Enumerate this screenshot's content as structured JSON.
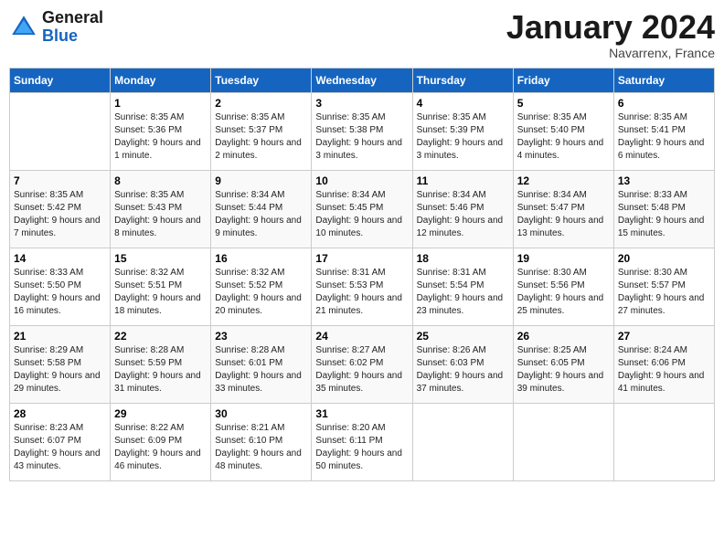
{
  "header": {
    "logo_general": "General",
    "logo_blue": "Blue",
    "month_title": "January 2024",
    "location": "Navarrenx, France"
  },
  "columns": [
    "Sunday",
    "Monday",
    "Tuesday",
    "Wednesday",
    "Thursday",
    "Friday",
    "Saturday"
  ],
  "weeks": [
    [
      {
        "day": "",
        "sunrise": "",
        "sunset": "",
        "daylight": ""
      },
      {
        "day": "1",
        "sunrise": "Sunrise: 8:35 AM",
        "sunset": "Sunset: 5:36 PM",
        "daylight": "Daylight: 9 hours and 1 minute."
      },
      {
        "day": "2",
        "sunrise": "Sunrise: 8:35 AM",
        "sunset": "Sunset: 5:37 PM",
        "daylight": "Daylight: 9 hours and 2 minutes."
      },
      {
        "day": "3",
        "sunrise": "Sunrise: 8:35 AM",
        "sunset": "Sunset: 5:38 PM",
        "daylight": "Daylight: 9 hours and 3 minutes."
      },
      {
        "day": "4",
        "sunrise": "Sunrise: 8:35 AM",
        "sunset": "Sunset: 5:39 PM",
        "daylight": "Daylight: 9 hours and 3 minutes."
      },
      {
        "day": "5",
        "sunrise": "Sunrise: 8:35 AM",
        "sunset": "Sunset: 5:40 PM",
        "daylight": "Daylight: 9 hours and 4 minutes."
      },
      {
        "day": "6",
        "sunrise": "Sunrise: 8:35 AM",
        "sunset": "Sunset: 5:41 PM",
        "daylight": "Daylight: 9 hours and 6 minutes."
      }
    ],
    [
      {
        "day": "7",
        "sunrise": "Sunrise: 8:35 AM",
        "sunset": "Sunset: 5:42 PM",
        "daylight": "Daylight: 9 hours and 7 minutes."
      },
      {
        "day": "8",
        "sunrise": "Sunrise: 8:35 AM",
        "sunset": "Sunset: 5:43 PM",
        "daylight": "Daylight: 9 hours and 8 minutes."
      },
      {
        "day": "9",
        "sunrise": "Sunrise: 8:34 AM",
        "sunset": "Sunset: 5:44 PM",
        "daylight": "Daylight: 9 hours and 9 minutes."
      },
      {
        "day": "10",
        "sunrise": "Sunrise: 8:34 AM",
        "sunset": "Sunset: 5:45 PM",
        "daylight": "Daylight: 9 hours and 10 minutes."
      },
      {
        "day": "11",
        "sunrise": "Sunrise: 8:34 AM",
        "sunset": "Sunset: 5:46 PM",
        "daylight": "Daylight: 9 hours and 12 minutes."
      },
      {
        "day": "12",
        "sunrise": "Sunrise: 8:34 AM",
        "sunset": "Sunset: 5:47 PM",
        "daylight": "Daylight: 9 hours and 13 minutes."
      },
      {
        "day": "13",
        "sunrise": "Sunrise: 8:33 AM",
        "sunset": "Sunset: 5:48 PM",
        "daylight": "Daylight: 9 hours and 15 minutes."
      }
    ],
    [
      {
        "day": "14",
        "sunrise": "Sunrise: 8:33 AM",
        "sunset": "Sunset: 5:50 PM",
        "daylight": "Daylight: 9 hours and 16 minutes."
      },
      {
        "day": "15",
        "sunrise": "Sunrise: 8:32 AM",
        "sunset": "Sunset: 5:51 PM",
        "daylight": "Daylight: 9 hours and 18 minutes."
      },
      {
        "day": "16",
        "sunrise": "Sunrise: 8:32 AM",
        "sunset": "Sunset: 5:52 PM",
        "daylight": "Daylight: 9 hours and 20 minutes."
      },
      {
        "day": "17",
        "sunrise": "Sunrise: 8:31 AM",
        "sunset": "Sunset: 5:53 PM",
        "daylight": "Daylight: 9 hours and 21 minutes."
      },
      {
        "day": "18",
        "sunrise": "Sunrise: 8:31 AM",
        "sunset": "Sunset: 5:54 PM",
        "daylight": "Daylight: 9 hours and 23 minutes."
      },
      {
        "day": "19",
        "sunrise": "Sunrise: 8:30 AM",
        "sunset": "Sunset: 5:56 PM",
        "daylight": "Daylight: 9 hours and 25 minutes."
      },
      {
        "day": "20",
        "sunrise": "Sunrise: 8:30 AM",
        "sunset": "Sunset: 5:57 PM",
        "daylight": "Daylight: 9 hours and 27 minutes."
      }
    ],
    [
      {
        "day": "21",
        "sunrise": "Sunrise: 8:29 AM",
        "sunset": "Sunset: 5:58 PM",
        "daylight": "Daylight: 9 hours and 29 minutes."
      },
      {
        "day": "22",
        "sunrise": "Sunrise: 8:28 AM",
        "sunset": "Sunset: 5:59 PM",
        "daylight": "Daylight: 9 hours and 31 minutes."
      },
      {
        "day": "23",
        "sunrise": "Sunrise: 8:28 AM",
        "sunset": "Sunset: 6:01 PM",
        "daylight": "Daylight: 9 hours and 33 minutes."
      },
      {
        "day": "24",
        "sunrise": "Sunrise: 8:27 AM",
        "sunset": "Sunset: 6:02 PM",
        "daylight": "Daylight: 9 hours and 35 minutes."
      },
      {
        "day": "25",
        "sunrise": "Sunrise: 8:26 AM",
        "sunset": "Sunset: 6:03 PM",
        "daylight": "Daylight: 9 hours and 37 minutes."
      },
      {
        "day": "26",
        "sunrise": "Sunrise: 8:25 AM",
        "sunset": "Sunset: 6:05 PM",
        "daylight": "Daylight: 9 hours and 39 minutes."
      },
      {
        "day": "27",
        "sunrise": "Sunrise: 8:24 AM",
        "sunset": "Sunset: 6:06 PM",
        "daylight": "Daylight: 9 hours and 41 minutes."
      }
    ],
    [
      {
        "day": "28",
        "sunrise": "Sunrise: 8:23 AM",
        "sunset": "Sunset: 6:07 PM",
        "daylight": "Daylight: 9 hours and 43 minutes."
      },
      {
        "day": "29",
        "sunrise": "Sunrise: 8:22 AM",
        "sunset": "Sunset: 6:09 PM",
        "daylight": "Daylight: 9 hours and 46 minutes."
      },
      {
        "day": "30",
        "sunrise": "Sunrise: 8:21 AM",
        "sunset": "Sunset: 6:10 PM",
        "daylight": "Daylight: 9 hours and 48 minutes."
      },
      {
        "day": "31",
        "sunrise": "Sunrise: 8:20 AM",
        "sunset": "Sunset: 6:11 PM",
        "daylight": "Daylight: 9 hours and 50 minutes."
      },
      {
        "day": "",
        "sunrise": "",
        "sunset": "",
        "daylight": ""
      },
      {
        "day": "",
        "sunrise": "",
        "sunset": "",
        "daylight": ""
      },
      {
        "day": "",
        "sunrise": "",
        "sunset": "",
        "daylight": ""
      }
    ]
  ]
}
